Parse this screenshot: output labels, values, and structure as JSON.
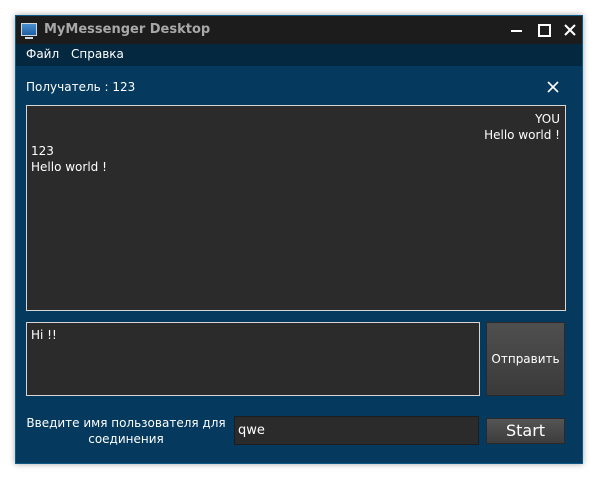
{
  "window": {
    "title": "MyMessenger Desktop"
  },
  "menu": {
    "file": "Файл",
    "help": "Справка"
  },
  "chat": {
    "recipient_label": "Получатель :",
    "recipient_value": "123",
    "messages": [
      {
        "direction": "out",
        "sender": "YOU",
        "text": "Hello world !"
      },
      {
        "direction": "in",
        "sender": "123",
        "text": "Hello world !"
      }
    ]
  },
  "compose": {
    "value": "Hi !!",
    "send_label": "Отправить"
  },
  "connect": {
    "username_label_line1": "Введите имя пользователя для",
    "username_label_line2": "соединения",
    "username_value": "qwe",
    "start_label": "Start"
  },
  "colors": {
    "window_bg": "#053a5e",
    "menubar_bg": "#04283f",
    "titlebar_bg": "#1c1c1c",
    "panel_bg": "#2b2b2b",
    "button_bg": "#4a4a4a"
  }
}
